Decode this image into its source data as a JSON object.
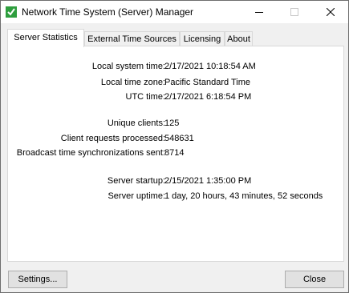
{
  "window": {
    "title": "Network Time System (Server) Manager"
  },
  "icons": {
    "app": "app-icon",
    "minimize": "minimize-icon",
    "maximize": "maximize-icon",
    "close": "close-icon"
  },
  "colors": {
    "app_icon_green": "#2e9e3e",
    "tab_active_bg": "#ffffff",
    "button_bg": "#e1e1e1"
  },
  "tabs": [
    {
      "label": "Server Statistics",
      "active": true
    },
    {
      "label": "External Time Sources",
      "active": false
    },
    {
      "label": "Licensing",
      "active": false
    },
    {
      "label": "About",
      "active": false
    }
  ],
  "stats": {
    "local_time": {
      "label": "Local system time:",
      "value": "2/17/2021 10:18:54 AM"
    },
    "time_zone": {
      "label": "Local time zone:",
      "value": "Pacific Standard Time"
    },
    "utc_time": {
      "label": "UTC time:",
      "value": "2/17/2021 6:18:54 PM"
    },
    "unique_clients": {
      "label": "Unique clients:",
      "value": "125"
    },
    "client_requests": {
      "label": "Client requests processed:",
      "value": "548631"
    },
    "broadcast_syncs": {
      "label": "Broadcast time synchronizations sent:",
      "value": "8714"
    },
    "server_startup": {
      "label": "Server startup:",
      "value": "2/15/2021 1:35:00 PM"
    },
    "server_uptime": {
      "label": "Server uptime:",
      "value": "1 day, 20 hours, 43 minutes, 52 seconds"
    }
  },
  "buttons": {
    "settings": "Settings...",
    "close": "Close"
  }
}
